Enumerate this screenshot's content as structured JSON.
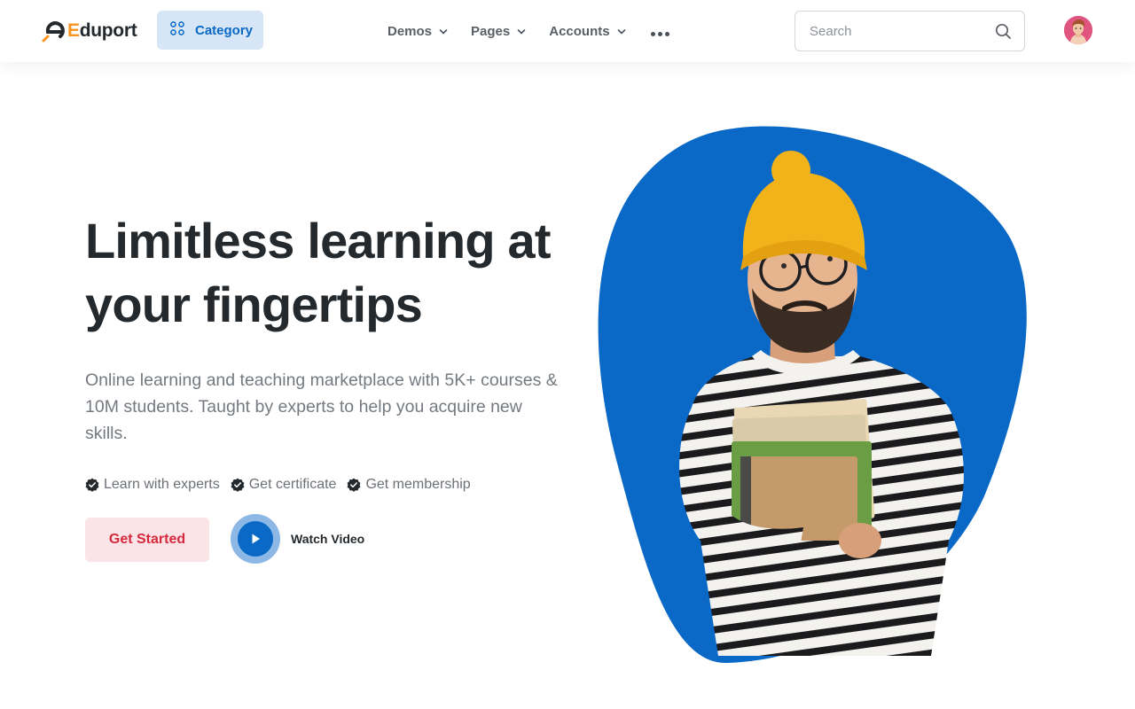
{
  "header": {
    "logo_text_accent": "E",
    "logo_text_rest": "duport",
    "category_label": "Category",
    "nav": [
      {
        "label": "Demos"
      },
      {
        "label": "Pages"
      },
      {
        "label": "Accounts"
      }
    ],
    "search_placeholder": "Search"
  },
  "hero": {
    "title_line1": "Limitless learning at",
    "title_line2": "your fingertips",
    "description": "Online learning and teaching marketplace with 5K+ courses & 10M students. Taught by experts to help you acquire new skills.",
    "features": [
      {
        "label": "Learn with experts"
      },
      {
        "label": "Get certificate"
      },
      {
        "label": "Get membership"
      }
    ],
    "cta_label": "Get Started",
    "video_label": "Watch Video"
  },
  "colors": {
    "primary": "#0a68c6",
    "accent_orange": "#f7941d",
    "cta_red": "#d6293e",
    "cta_bg": "#fbe4e7",
    "blob_blue": "#0a68c6"
  },
  "icons": {
    "category": "grid-icon",
    "search": "search-icon",
    "feature": "check-badge-icon",
    "play": "play-icon",
    "more": "more-dots-icon"
  }
}
